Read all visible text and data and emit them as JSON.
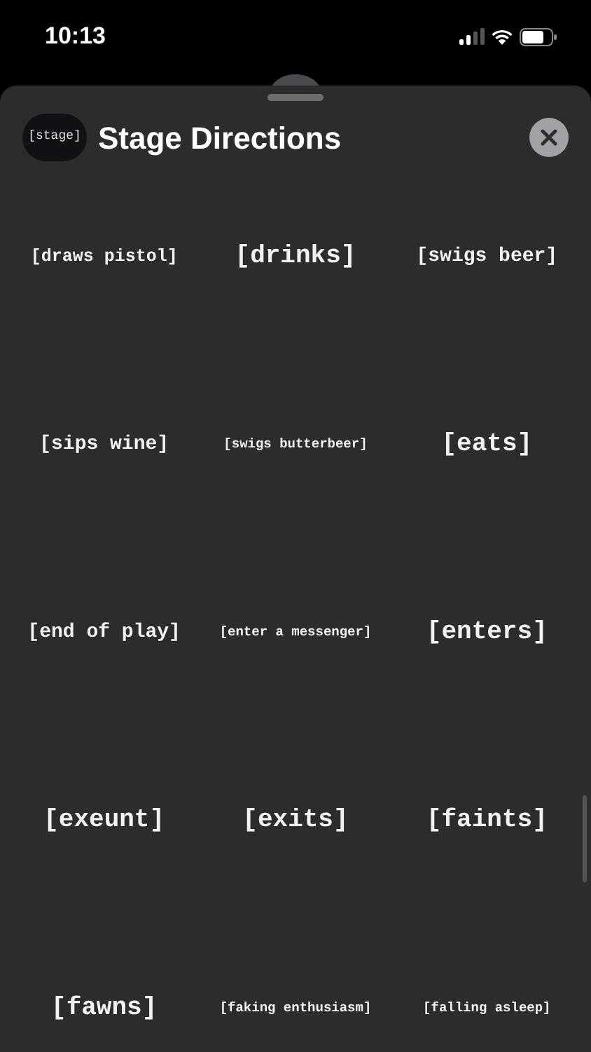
{
  "status_bar": {
    "time": "10:13"
  },
  "sheet": {
    "title": "Stage Directions",
    "app_icon_label": "[stage]"
  },
  "stickers": [
    {
      "text": "[draws pistol]",
      "kind": "small"
    },
    {
      "text": "[drinks]",
      "kind": "large"
    },
    {
      "text": "[swigs beer]",
      "kind": "medium"
    },
    {
      "text": "[sips wine]",
      "kind": "medium"
    },
    {
      "text": "[swigs butterbeer]",
      "kind": "tiny"
    },
    {
      "text": "[eats]",
      "kind": "large"
    },
    {
      "text": "[end of play]",
      "kind": "medium"
    },
    {
      "text": "[enter a messenger]",
      "kind": "tiny"
    },
    {
      "text": "[enters]",
      "kind": "large"
    },
    {
      "text": "[exeunt]",
      "kind": "large"
    },
    {
      "text": "[exits]",
      "kind": "large"
    },
    {
      "text": "[faints]",
      "kind": "large"
    },
    {
      "text": "[fawns]",
      "kind": "large"
    },
    {
      "text": "[faking enthusiasm]",
      "kind": "tiny"
    },
    {
      "text": "[falling asleep]",
      "kind": "tiny"
    }
  ]
}
